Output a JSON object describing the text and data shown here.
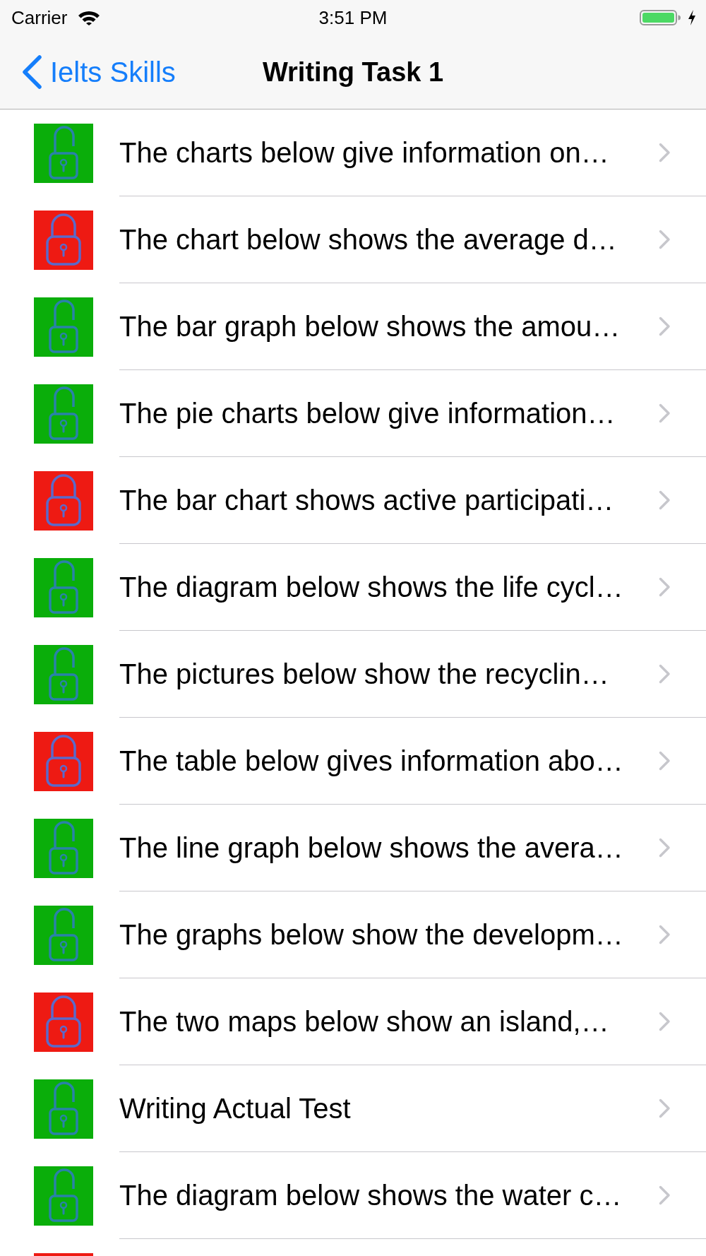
{
  "status_bar": {
    "carrier": "Carrier",
    "time": "3:51 PM"
  },
  "nav_bar": {
    "back_label": "Ielts Skills",
    "title": "Writing Task 1"
  },
  "rows": [
    {
      "title": "The charts below give information on…",
      "locked": false
    },
    {
      "title": "The chart below shows the average d…",
      "locked": true
    },
    {
      "title": "The bar graph below shows the amou…",
      "locked": false
    },
    {
      "title": "The pie charts below give information…",
      "locked": false
    },
    {
      "title": "The bar chart shows active participati…",
      "locked": true
    },
    {
      "title": "The diagram below shows the life cycl…",
      "locked": false
    },
    {
      "title": "The pictures below show the recyclin…",
      "locked": false
    },
    {
      "title": "The table below gives information abo…",
      "locked": true
    },
    {
      "title": "The line graph below shows the avera…",
      "locked": false
    },
    {
      "title": "The graphs below show the developm…",
      "locked": false
    },
    {
      "title": "The two maps below show an island,…",
      "locked": true
    },
    {
      "title": "Writing Actual Test",
      "locked": false
    },
    {
      "title": "The diagram below shows the water c…",
      "locked": false
    },
    {
      "locked": true
    }
  ]
}
